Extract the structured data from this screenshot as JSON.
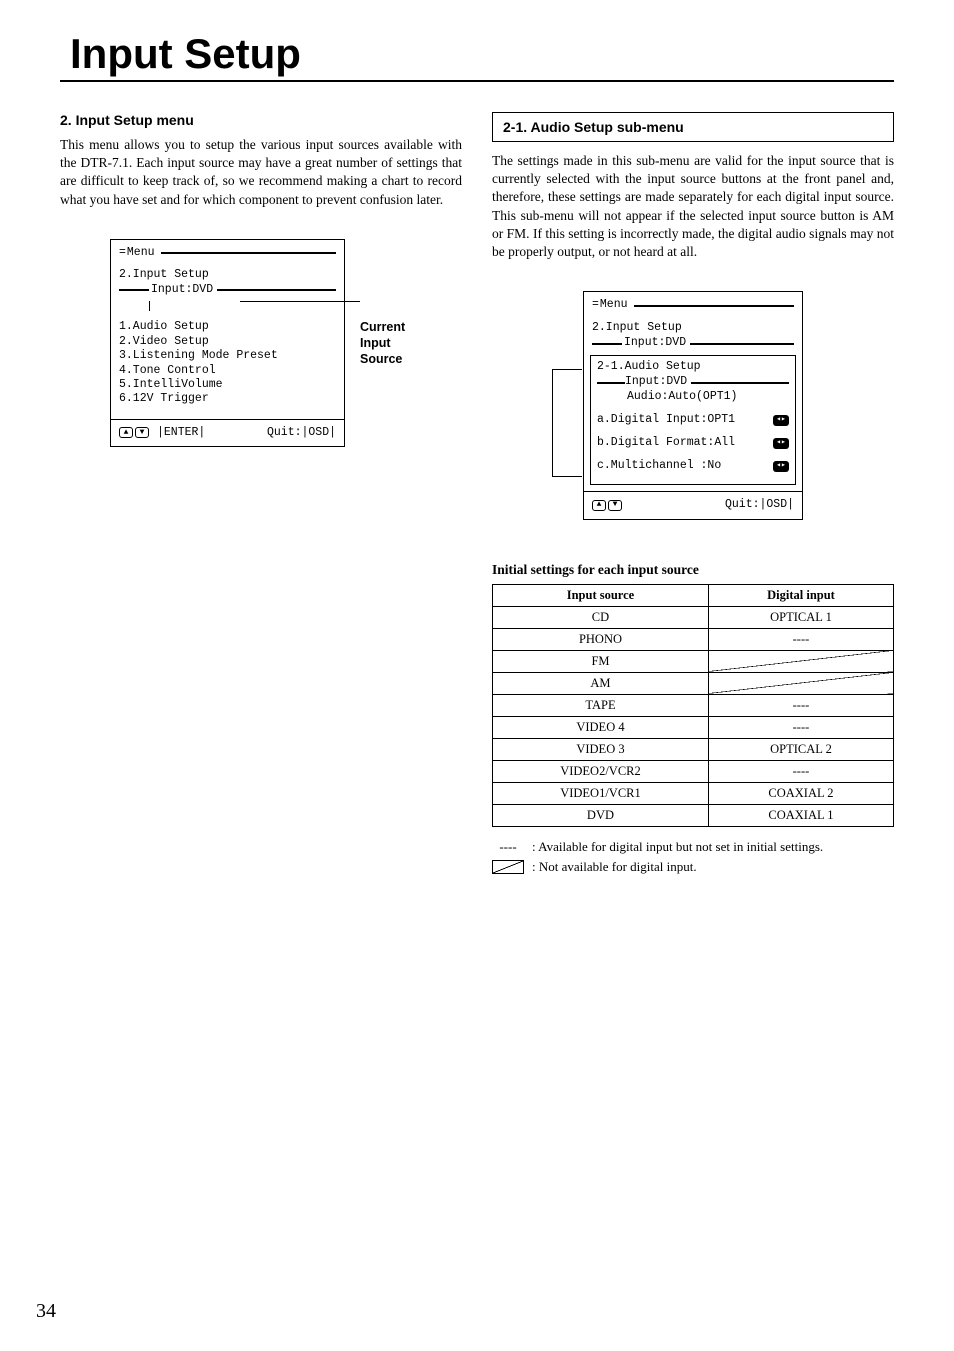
{
  "page_title": "Input Setup",
  "page_number": "34",
  "left": {
    "heading": "2. Input Setup menu",
    "body": "This menu allows you to setup the various input sources available with the DTR-7.1. Each input source may have a great number of settings that are difficult to keep track of, so we recommend making a chart to record what you have set and for which component to prevent confusion later.",
    "osd": {
      "menu_label": "Menu",
      "section": "2.Input Setup",
      "input_label": "Input:DVD",
      "items": "1.Audio Setup\n2.Video Setup\n3.Listening Mode Preset\n4.Tone Control\n5.IntelliVolume\n6.12V Trigger",
      "footer_enter": "|ENTER|",
      "footer_quit": "Quit:|OSD|"
    },
    "callout": "Current\nInput\nSource"
  },
  "right": {
    "sub_heading": "2-1. Audio Setup sub-menu",
    "body": "The settings made in this sub-menu are valid for the input source that is currently selected with the input source buttons at the front panel and, therefore, these settings are made separately for each digital input source. This sub-menu will not appear if the selected input source button is AM or FM. If this setting is incorrectly made, the digital audio signals may not be properly output, or not heard at all.",
    "osd": {
      "menu_label": "Menu",
      "section": "2.Input Setup",
      "input_label": "Input:DVD",
      "sub_section": "2-1.Audio Setup",
      "sub_input": "Input:DVD",
      "audio_line": "Audio:Auto(OPT1)",
      "item_a": "a.Digital Input:OPT1",
      "item_b": "b.Digital Format:All",
      "item_c": "c.Multichannel  :No",
      "footer_quit": "Quit:|OSD|"
    },
    "table_title": "Initial settings for each input source",
    "table_headers": [
      "Input source",
      "Digital input"
    ],
    "table_rows": [
      {
        "src": "CD",
        "dig": "OPTICAL 1",
        "na": false
      },
      {
        "src": "PHONO",
        "dig": "----",
        "na": false
      },
      {
        "src": "FM",
        "dig": "",
        "na": true
      },
      {
        "src": "AM",
        "dig": "",
        "na": true
      },
      {
        "src": "TAPE",
        "dig": "----",
        "na": false
      },
      {
        "src": "VIDEO 4",
        "dig": "----",
        "na": false
      },
      {
        "src": "VIDEO 3",
        "dig": "OPTICAL 2",
        "na": false
      },
      {
        "src": "VIDEO2/VCR2",
        "dig": "----",
        "na": false
      },
      {
        "src": "VIDEO1/VCR1",
        "dig": "COAXIAL 2",
        "na": false
      },
      {
        "src": "DVD",
        "dig": "COAXIAL 1",
        "na": false
      }
    ],
    "legend_dash_symbol": "----",
    "legend_dash": ": Available for digital input but not set in initial settings.",
    "legend_na": ": Not available for digital input."
  }
}
